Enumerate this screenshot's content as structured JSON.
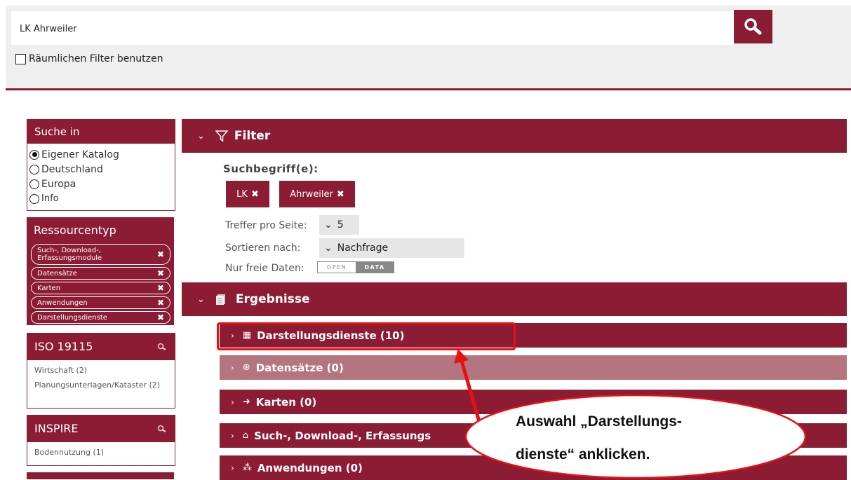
{
  "search": {
    "value": "LK Ahrweiler"
  },
  "spatial_filter": {
    "label": "Räumlichen Filter benutzen"
  },
  "sidebar": {
    "suche_in": {
      "title": "Suche in",
      "options": [
        {
          "label": "Eigener Katalog",
          "selected": true
        },
        {
          "label": "Deutschland",
          "selected": false
        },
        {
          "label": "Europa",
          "selected": false
        },
        {
          "label": "Info",
          "selected": false
        }
      ]
    },
    "ressourcentyp": {
      "title": "Ressourcentyp",
      "items": [
        {
          "label": "Such-, Download-, Erfassungsmodule"
        },
        {
          "label": "Datensätze"
        },
        {
          "label": "Karten"
        },
        {
          "label": "Anwendungen"
        },
        {
          "label": "Darstellungsdienste"
        }
      ]
    },
    "iso": {
      "title": "ISO 19115",
      "items": [
        "Wirtschaft (2)",
        "Planungsunterlagen/Kataster (2)"
      ]
    },
    "inspire": {
      "title": "INSPIRE",
      "items": [
        "Bodennutzung (1)"
      ]
    }
  },
  "filter": {
    "title": "Filter",
    "search_terms_label": "Suchbegriff(e):",
    "terms": [
      "LK",
      "Ahrweiler"
    ],
    "per_page_label": "Treffer pro Seite:",
    "per_page_value": "5",
    "sort_label": "Sortieren nach:",
    "sort_value": "Nachfrage",
    "free_label": "Nur freie Daten:",
    "open_text": "OPEN",
    "data_text": "DATA"
  },
  "results": {
    "title": "Ergebnisse",
    "rows": [
      {
        "label": "Darstellungsdienste (10)"
      },
      {
        "label": "Datensätze (0)"
      },
      {
        "label": "Karten (0)"
      },
      {
        "label": "Such-, Download-, Erfassungs"
      },
      {
        "label": "Anwendungen (0)"
      }
    ]
  },
  "callout": {
    "line1": "Auswahl „Darstellungs-",
    "line2": "dienste“ anklicken."
  },
  "colors": {
    "accent": "#8b1c33",
    "accent_light": "#b57580",
    "highlight": "#e81010"
  }
}
